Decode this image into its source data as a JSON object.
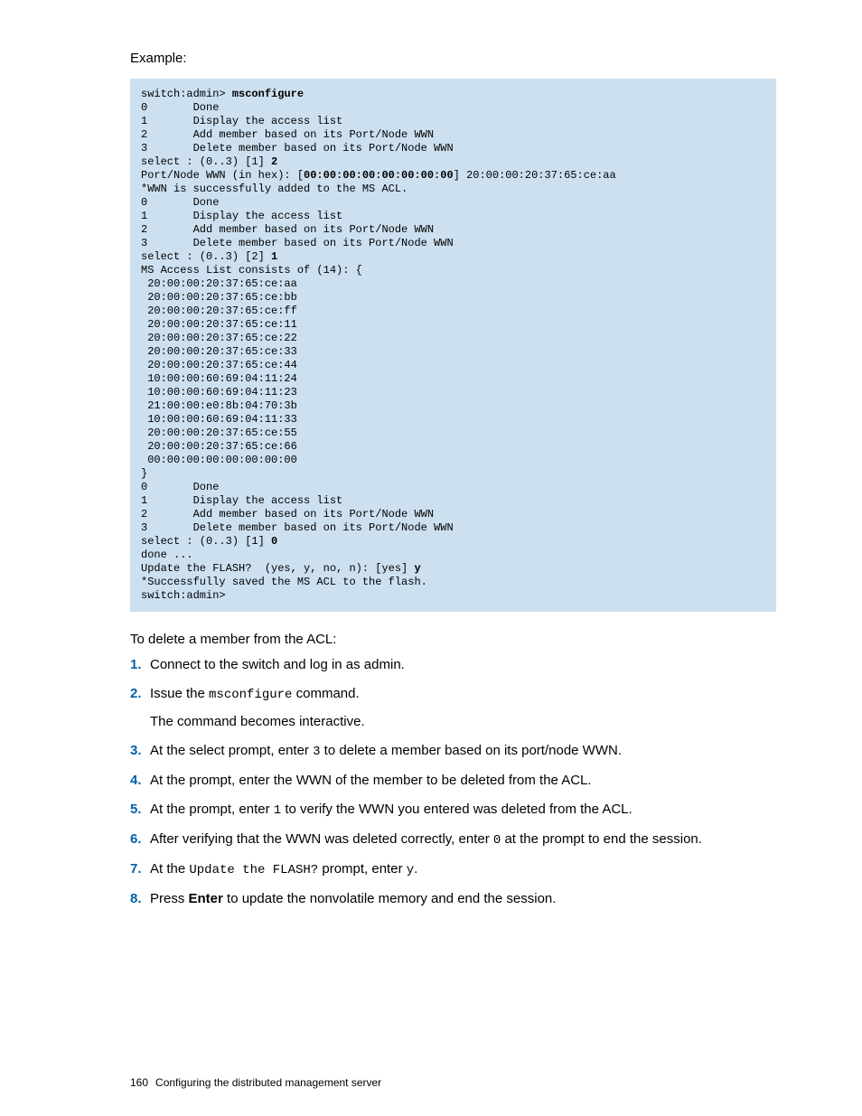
{
  "example_label": "Example:",
  "code": {
    "l01a": "switch:admin> ",
    "l01b": "msconfigure",
    "l02": "0       Done",
    "l03": "1       Display the access list",
    "l04": "2       Add member based on its Port/Node WWN",
    "l05": "3       Delete member based on its Port/Node WWN",
    "l06a": "select : (0..3) [1] ",
    "l06b": "2",
    "l07a": "Port/Node WWN (in hex): [",
    "l07b": "00:00:00:00:00:00:00:00",
    "l07c": "] 20:00:00:20:37:65:ce:aa",
    "l08": "*WWN is successfully added to the MS ACL.",
    "l09": "0       Done",
    "l10": "1       Display the access list",
    "l11": "2       Add member based on its Port/Node WWN",
    "l12": "3       Delete member based on its Port/Node WWN",
    "l13a": "select : (0..3) [2] ",
    "l13b": "1",
    "l14": "MS Access List consists of (14): {",
    "l15": " 20:00:00:20:37:65:ce:aa",
    "l16": " 20:00:00:20:37:65:ce:bb",
    "l17": " 20:00:00:20:37:65:ce:ff",
    "l18": " 20:00:00:20:37:65:ce:11",
    "l19": " 20:00:00:20:37:65:ce:22",
    "l20": " 20:00:00:20:37:65:ce:33",
    "l21": " 20:00:00:20:37:65:ce:44",
    "l22": " 10:00:00:60:69:04:11:24",
    "l23": " 10:00:00:60:69:04:11:23",
    "l24": " 21:00:00:e0:8b:04:70:3b",
    "l25": " 10:00:00:60:69:04:11:33",
    "l26": " 20:00:00:20:37:65:ce:55",
    "l27": " 20:00:00:20:37:65:ce:66",
    "l28": " 00:00:00:00:00:00:00:00",
    "l29": "}",
    "l30": "0       Done",
    "l31": "1       Display the access list",
    "l32": "2       Add member based on its Port/Node WWN",
    "l33": "3       Delete member based on its Port/Node WWN",
    "l34a": "select : (0..3) [1] ",
    "l34b": "0",
    "l35": "done ...",
    "l36a": "Update the FLASH?  (yes, y, no, n): [yes] ",
    "l36b": "y",
    "l37": "*Successfully saved the MS ACL to the flash.",
    "l38": "switch:admin>"
  },
  "intro": "To delete a member from the ACL:",
  "steps": {
    "s1": "Connect to the switch and log in as admin.",
    "s2a": "Issue the ",
    "s2b": "msconfigure",
    "s2c": " command.",
    "s2sub": "The command becomes interactive.",
    "s3a": "At the select prompt, enter ",
    "s3b": "3",
    "s3c": " to delete a member based on its port/node WWN.",
    "s4": "At the prompt, enter the WWN of the member to be deleted from the ACL.",
    "s5a": "At the prompt, enter ",
    "s5b": "1",
    "s5c": " to verify the WWN you entered was deleted from the ACL.",
    "s6a": "After verifying that the WWN was deleted correctly, enter ",
    "s6b": "0",
    "s6c": " at the prompt to end the session.",
    "s7a": "At the ",
    "s7b": "Update the FLASH?",
    "s7c": " prompt, enter ",
    "s7d": "y",
    "s7e": ".",
    "s8a": "Press ",
    "s8b": "Enter",
    "s8c": " to update the nonvolatile memory and end the session."
  },
  "footer": {
    "page": "160",
    "title": "Configuring the distributed management server"
  }
}
